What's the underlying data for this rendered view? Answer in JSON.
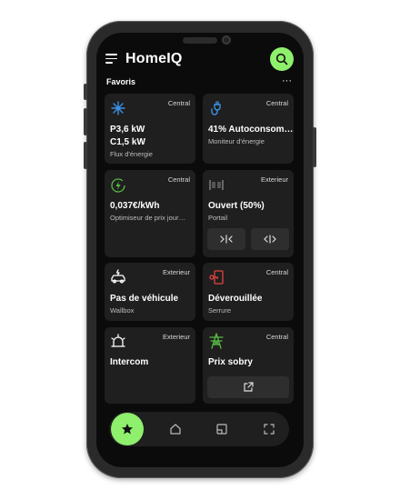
{
  "app": {
    "title": "HomeIQ"
  },
  "section": {
    "title": "Favoris",
    "more": "···"
  },
  "cards": [
    {
      "tag": "Central",
      "line1": "P3,6 kW",
      "line2": "C1,5 kW",
      "sub": "Flux d'énergie",
      "icon": "network-icon"
    },
    {
      "tag": "Central",
      "line1": "41% Autoconsom…",
      "sub": "Moniteur d'énergie",
      "icon": "plug-icon"
    },
    {
      "tag": "Central",
      "line1": "0,037€/kWh",
      "sub": "Optimiseur de prix jour…",
      "icon": "lightning-icon"
    },
    {
      "tag": "Exterieur",
      "line1": "Ouvert (50%)",
      "sub": "Portail",
      "icon": "gate-icon"
    },
    {
      "tag": "Exterieur",
      "line1": "Pas de véhicule",
      "sub": "Wallbox",
      "icon": "car-charger-icon"
    },
    {
      "tag": "Central",
      "line1": "Déverouillée",
      "sub": "Serrure",
      "icon": "lock-icon"
    },
    {
      "tag": "Exterieur",
      "line1": "Intercom",
      "icon": "bell-icon"
    },
    {
      "tag": "Central",
      "line1": "Prix sobry",
      "icon": "tower-icon"
    }
  ],
  "nav": [
    "star-icon",
    "home-icon",
    "widget-icon",
    "scan-icon"
  ],
  "colors": {
    "accent": "#8ef06c",
    "blue": "#3b8fe3",
    "red": "#e2443f",
    "green": "#58b944"
  }
}
